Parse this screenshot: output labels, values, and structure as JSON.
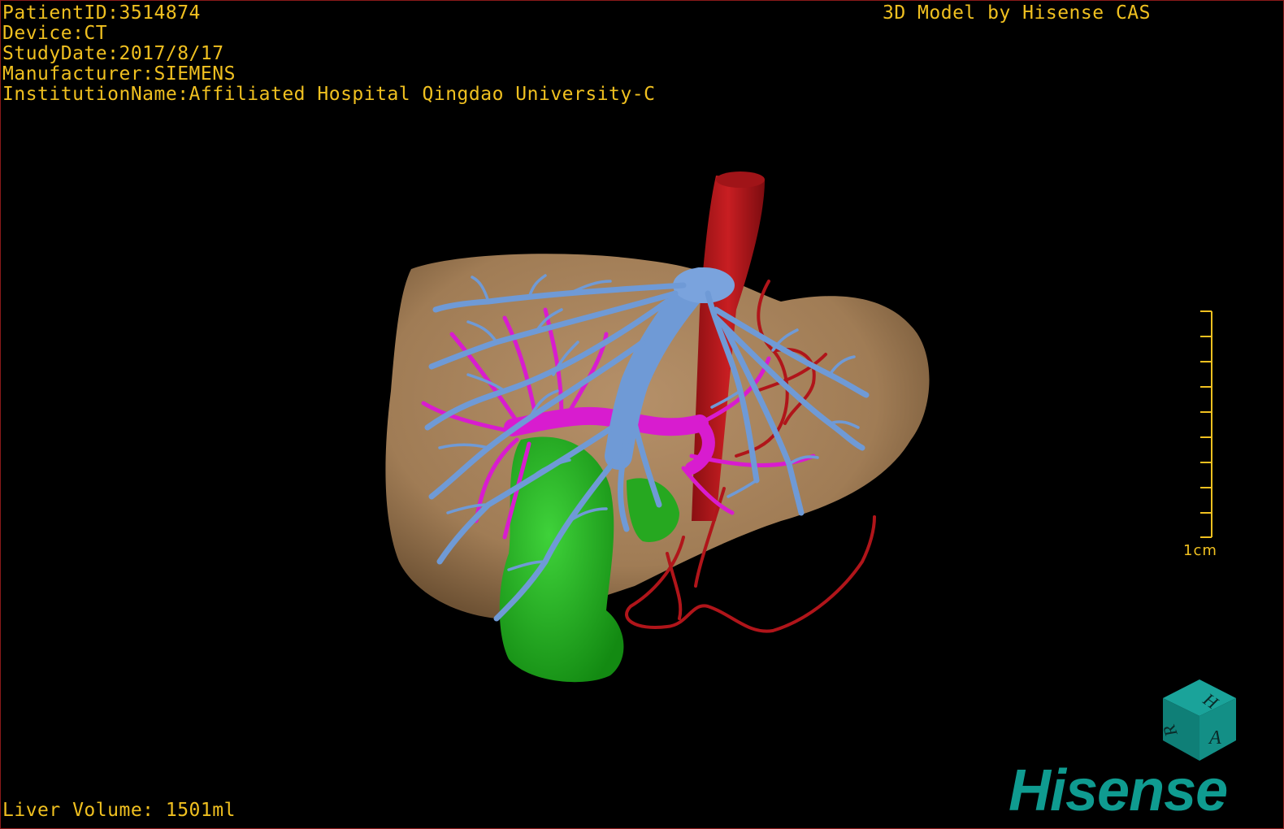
{
  "patient_info": {
    "patient_id": "PatientID:3514874",
    "device": "Device:CT",
    "study_date": "StudyDate:2017/8/17",
    "manufacturer": "Manufacturer:SIEMENS",
    "institution": "InstitutionName:Affiliated Hospital Qingdao University-C"
  },
  "credit": "3D Model by Hisense CAS",
  "volume_readout": "Liver Volume: 1501ml",
  "scale": {
    "label": "1cm",
    "tick_count": 10
  },
  "orientation_cube": {
    "icon": "orientation-cube-icon",
    "faces": [
      "H",
      "R",
      "A"
    ]
  },
  "brand": {
    "name": "Hisense",
    "color": "#0f9b90"
  },
  "colors": {
    "overlay_text": "#f0c020",
    "liver": "#a8845e",
    "hepatic_vein": "#6f9ad6",
    "portal_vein": "#d81ccf",
    "artery": "#b0151a",
    "gallbladder": "#22b01c"
  }
}
